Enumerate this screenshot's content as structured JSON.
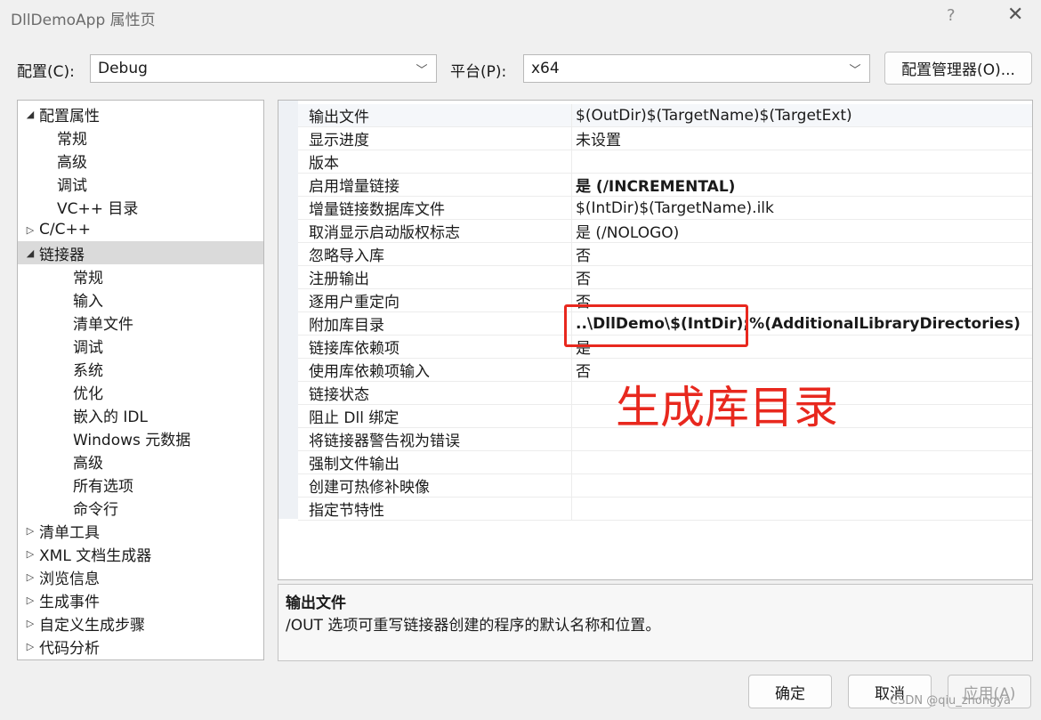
{
  "window": {
    "title": "DllDemoApp 属性页",
    "help_glyph": "?",
    "close_glyph": "✕"
  },
  "config_bar": {
    "config_label": "配置(C):",
    "config_value": "Debug",
    "platform_label": "平台(P):",
    "platform_value": "x64",
    "manager_button": "配置管理器(O)..."
  },
  "tree": {
    "items": [
      {
        "label": "配置属性",
        "arrow": "◢"
      },
      {
        "label": "常规",
        "arrow": ""
      },
      {
        "label": "高级",
        "arrow": ""
      },
      {
        "label": "调试",
        "arrow": ""
      },
      {
        "label": "VC++ 目录",
        "arrow": ""
      },
      {
        "label": "C/C++",
        "arrow": "▷"
      },
      {
        "label": "链接器",
        "arrow": "◢"
      },
      {
        "label": "常规",
        "arrow": ""
      },
      {
        "label": "输入",
        "arrow": ""
      },
      {
        "label": "清单文件",
        "arrow": ""
      },
      {
        "label": "调试",
        "arrow": ""
      },
      {
        "label": "系统",
        "arrow": ""
      },
      {
        "label": "优化",
        "arrow": ""
      },
      {
        "label": "嵌入的 IDL",
        "arrow": ""
      },
      {
        "label": "Windows 元数据",
        "arrow": ""
      },
      {
        "label": "高级",
        "arrow": ""
      },
      {
        "label": "所有选项",
        "arrow": ""
      },
      {
        "label": "命令行",
        "arrow": ""
      },
      {
        "label": "清单工具",
        "arrow": "▷"
      },
      {
        "label": "XML 文档生成器",
        "arrow": "▷"
      },
      {
        "label": "浏览信息",
        "arrow": "▷"
      },
      {
        "label": "生成事件",
        "arrow": "▷"
      },
      {
        "label": "自定义生成步骤",
        "arrow": "▷"
      },
      {
        "label": "代码分析",
        "arrow": "▷"
      }
    ],
    "selected_index": 6
  },
  "grid": {
    "rows": [
      {
        "name": "输出文件",
        "value": "$(OutDir)$(TargetName)$(TargetExt)",
        "bold": false
      },
      {
        "name": "显示进度",
        "value": "未设置",
        "bold": false
      },
      {
        "name": "版本",
        "value": "",
        "bold": false
      },
      {
        "name": "启用增量链接",
        "value": "是 (/INCREMENTAL)",
        "bold": true
      },
      {
        "name": "增量链接数据库文件",
        "value": "$(IntDir)$(TargetName).ilk",
        "bold": false
      },
      {
        "name": "取消显示启动版权标志",
        "value": "是 (/NOLOGO)",
        "bold": false
      },
      {
        "name": "忽略导入库",
        "value": "否",
        "bold": false
      },
      {
        "name": "注册输出",
        "value": "否",
        "bold": false
      },
      {
        "name": "逐用户重定向",
        "value": "否",
        "bold": false
      },
      {
        "name": "附加库目录",
        "value": "..\\DllDemo\\$(IntDir);%(AdditionalLibraryDirectories)",
        "bold": true
      },
      {
        "name": "链接库依赖项",
        "value": "是",
        "bold": false
      },
      {
        "name": "使用库依赖项输入",
        "value": "否",
        "bold": false
      },
      {
        "name": "链接状态",
        "value": "",
        "bold": false
      },
      {
        "name": "阻止 Dll 绑定",
        "value": "",
        "bold": false
      },
      {
        "name": "将链接器警告视为错误",
        "value": "",
        "bold": false
      },
      {
        "name": "强制文件输出",
        "value": "",
        "bold": false
      },
      {
        "name": "创建可热修补映像",
        "value": "",
        "bold": false
      },
      {
        "name": "指定节特性",
        "value": "",
        "bold": false
      }
    ]
  },
  "description": {
    "title": "输出文件",
    "text": "/OUT 选项可重写链接器创建的程序的默认名称和位置。"
  },
  "buttons": {
    "ok": "确定",
    "cancel": "取消",
    "apply": "应用(A)"
  },
  "annotation": {
    "text": "生成库目录",
    "color": "#e8281e"
  },
  "watermark": "CSDN @qiu_zhongya",
  "colors": {
    "selection": "#dadada",
    "annotation_red": "#e8281e"
  }
}
